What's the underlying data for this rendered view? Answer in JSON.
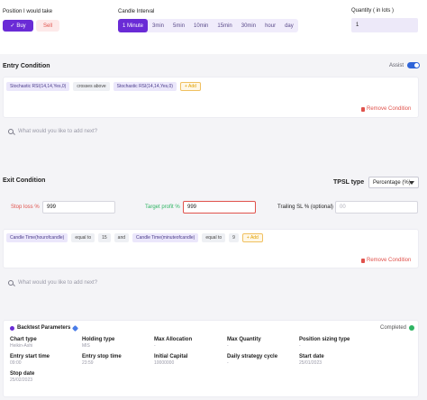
{
  "top": {
    "position_label": "Position I would take",
    "buy_label": "Buy",
    "sell_label": "Sell",
    "interval_label": "Candle Interval",
    "intervals": [
      "1 Minute",
      "3min",
      "5min",
      "10min",
      "15min",
      "30min",
      "hour",
      "day"
    ],
    "active_interval": "1 Minute",
    "quantity_label": "Quantity ( in lots )",
    "quantity_value": "1"
  },
  "entry": {
    "title": "Entry Condition",
    "assist_label": "Assist",
    "condition": [
      "Stochastic RSI(14,14,Yes,0)",
      "crosses above",
      "Stochastic RSI(14,14,Yes,0)"
    ],
    "add_label": "+ Add",
    "remove_label": "Remove Condition",
    "search_placeholder": "What would you like to add next?"
  },
  "exit": {
    "title": "Exit Condition",
    "tpsl_label": "TPSL type",
    "tpsl_value": "Percentage (%)",
    "stop_loss_label": "Stop loss %",
    "stop_loss_value": "999",
    "target_label": "Target profit %",
    "target_value": "999",
    "trailing_label": "Trailing SL % (optional)",
    "trailing_placeholder": "00",
    "condition": [
      "Candle Time(hourofcandle)",
      "equal to",
      "15",
      "and",
      "Candle Time(minuteofcandle)",
      "equal to",
      "9"
    ],
    "add_label": "+ Add",
    "remove_label": "Remove Condition",
    "search_placeholder": "What would you like to add next?"
  },
  "backtest": {
    "title": "Backtest Parameters",
    "status": "Completed",
    "params": [
      {
        "key": "Chart type",
        "value": "Heikin-Ashi"
      },
      {
        "key": "Holding type",
        "value": "MIS"
      },
      {
        "key": "Max Allocation",
        "value": "-"
      },
      {
        "key": "Max Quantity",
        "value": "-"
      },
      {
        "key": "Position sizing type",
        "value": "-"
      },
      {
        "key": "Entry start time",
        "value": "09:00"
      },
      {
        "key": "Entry stop time",
        "value": "23:59"
      },
      {
        "key": "Initial Capital",
        "value": "10000000"
      },
      {
        "key": "Daily strategy cycle",
        "value": "-"
      },
      {
        "key": "Start date",
        "value": "25/01/2023"
      },
      {
        "key": "Stop date",
        "value": "25/02/2023"
      }
    ]
  },
  "colors": {
    "accent": "#6a2bd6",
    "danger": "#e0524c",
    "success": "#2fb463",
    "toggle": "#2e64d8",
    "add_chip": "#e0a000"
  }
}
